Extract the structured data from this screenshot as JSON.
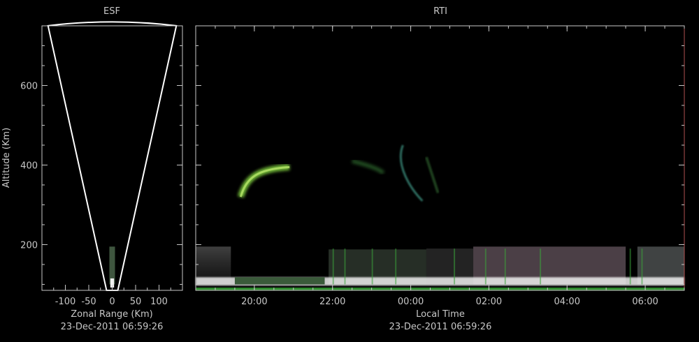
{
  "chart_data": [
    {
      "type": "heatmap",
      "title": "ESF",
      "xlabel": "Zonal Range (Km)",
      "ylabel": "Altitude (Km)",
      "footer": "23-Dec-2011 06:59:26",
      "xlim": [
        -150,
        150
      ],
      "ylim": [
        85,
        750
      ],
      "x_ticks": [
        {
          "value": -100,
          "label": "-100"
        },
        {
          "value": -50,
          "label": "-50"
        },
        {
          "value": 0,
          "label": "0"
        },
        {
          "value": 50,
          "label": "50"
        },
        {
          "value": 100,
          "label": "100"
        }
      ],
      "y_ticks": [
        {
          "value": 200,
          "label": "200"
        },
        {
          "value": 400,
          "label": "400"
        },
        {
          "value": 600,
          "label": "600"
        }
      ],
      "beam_sector": {
        "apex_altitude": 85,
        "top_altitude": 745,
        "half_width_at_top_km": 137
      }
    },
    {
      "type": "heatmap",
      "title": "RTI",
      "xlabel": "Local Time",
      "footer": "23-Dec-2011 06:59:26",
      "xlim": [
        "18:30",
        "07:00"
      ],
      "ylim": [
        85,
        750
      ],
      "x_ticks": [
        "20:00",
        "22:00",
        "00:00",
        "02:00",
        "04:00",
        "06:00"
      ],
      "y_ticks": [
        {
          "value": 200,
          "label": ""
        },
        {
          "value": 400,
          "label": ""
        },
        {
          "value": 600,
          "label": ""
        }
      ]
    }
  ],
  "colors": {
    "background": "#000000",
    "axis": "#c8c8c8",
    "echo_green": "#7cc83c",
    "echo_white": "#f0f0f0",
    "echo_pink": "#d8b4c8"
  }
}
